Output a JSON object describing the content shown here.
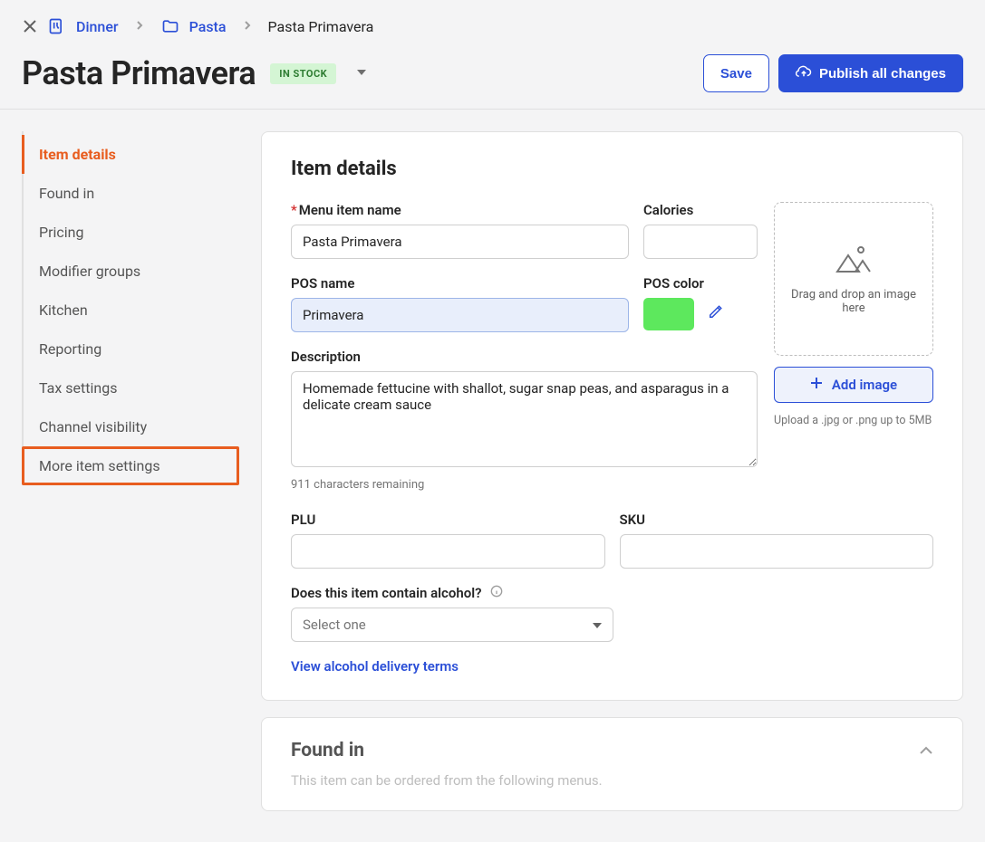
{
  "breadcrumb": {
    "level1": "Dinner",
    "level2": "Pasta",
    "current": "Pasta Primavera"
  },
  "header": {
    "title": "Pasta Primavera",
    "stock_badge": "IN STOCK",
    "save_label": "Save",
    "publish_label": "Publish all changes"
  },
  "sidebar": {
    "items": [
      "Item details",
      "Found in",
      "Pricing",
      "Modifier groups",
      "Kitchen",
      "Reporting",
      "Tax settings",
      "Channel visibility",
      "More item settings"
    ]
  },
  "details": {
    "heading": "Item details",
    "name_label": "Menu item name",
    "name_value": "Pasta Primavera",
    "calories_label": "Calories",
    "calories_value": "",
    "posname_label": "POS name",
    "posname_value": "Primavera",
    "poscolor_label": "POS color",
    "desc_label": "Description",
    "desc_value": "Homemade fettucine with shallot, sugar snap peas, and asparagus in a delicate cream sauce",
    "desc_helper": "911 characters remaining",
    "plu_label": "PLU",
    "plu_value": "",
    "sku_label": "SKU",
    "sku_value": "",
    "alcohol_label": "Does this item contain alcohol?",
    "alcohol_placeholder": "Select one",
    "alcohol_link": "View alcohol delivery terms",
    "dropzone_text": "Drag and drop an image here",
    "add_image_label": "Add image",
    "image_helper": "Upload a .jpg or .png up to 5MB"
  },
  "found": {
    "title": "Found in",
    "subtitle": "This item can be ordered from the following menus."
  }
}
